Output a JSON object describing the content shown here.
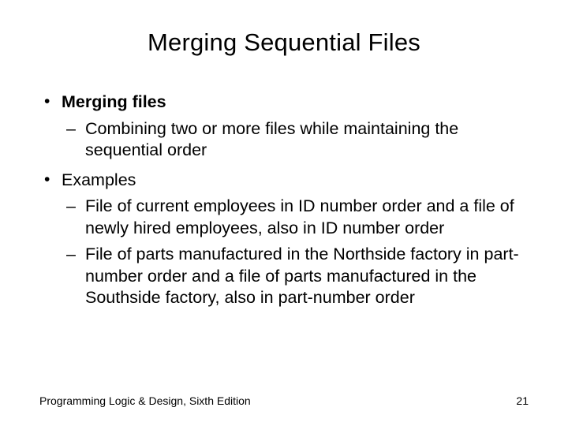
{
  "title": "Merging Sequential Files",
  "bullets": [
    {
      "head": "Merging files",
      "bold": true,
      "subs": [
        "Combining two or more files while maintaining the sequential order"
      ]
    },
    {
      "head": "Examples",
      "bold": false,
      "subs": [
        "File of current employees in ID number order and a file of newly hired employees, also in ID number order",
        "File of parts manufactured in the Northside factory in part-number order and a file of parts manufactured in the Southside factory, also in part-number order"
      ]
    }
  ],
  "footer": {
    "left": "Programming Logic & Design, Sixth Edition",
    "right": "21"
  }
}
